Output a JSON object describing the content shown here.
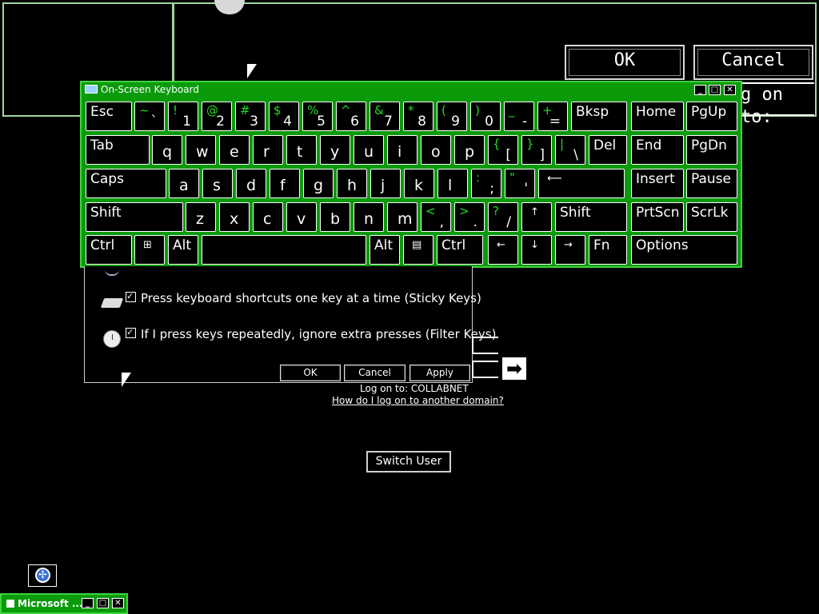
{
  "magnifier": {
    "ok_label": "OK",
    "cancel_label": "Cancel",
    "logon_partial": "g on to:"
  },
  "osk": {
    "title": "On-Screen Keyboard",
    "rows": [
      [
        {
          "id": "esc",
          "label": "Esc"
        },
        {
          "id": "backtick",
          "shift": "~",
          "main": "`"
        },
        {
          "id": "1",
          "shift": "!",
          "main": "1"
        },
        {
          "id": "2",
          "shift": "@",
          "main": "2"
        },
        {
          "id": "3",
          "shift": "#",
          "main": "3"
        },
        {
          "id": "4",
          "shift": "$",
          "main": "4"
        },
        {
          "id": "5",
          "shift": "%",
          "main": "5"
        },
        {
          "id": "6",
          "shift": "^",
          "main": "6"
        },
        {
          "id": "7",
          "shift": "&",
          "main": "7"
        },
        {
          "id": "8",
          "shift": "*",
          "main": "8"
        },
        {
          "id": "9",
          "shift": "(",
          "main": "9"
        },
        {
          "id": "0",
          "shift": ")",
          "main": "0"
        },
        {
          "id": "minus",
          "shift": "_",
          "main": "-"
        },
        {
          "id": "equals",
          "shift": "+",
          "main": "="
        },
        {
          "id": "bksp",
          "label": "Bksp"
        },
        {
          "id": "home",
          "label": "Home"
        },
        {
          "id": "pgup",
          "label": "PgUp"
        }
      ],
      [
        {
          "id": "tab",
          "label": "Tab"
        },
        {
          "id": "q",
          "single": "q"
        },
        {
          "id": "w",
          "single": "w"
        },
        {
          "id": "e",
          "single": "e"
        },
        {
          "id": "r",
          "single": "r"
        },
        {
          "id": "t",
          "single": "t"
        },
        {
          "id": "y",
          "single": "y"
        },
        {
          "id": "u",
          "single": "u"
        },
        {
          "id": "i",
          "single": "i"
        },
        {
          "id": "o",
          "single": "o"
        },
        {
          "id": "p",
          "single": "p"
        },
        {
          "id": "lbracket",
          "shift": "{",
          "main": "["
        },
        {
          "id": "rbracket",
          "shift": "}",
          "main": "]"
        },
        {
          "id": "backslash",
          "shift": "|",
          "main": "\\"
        },
        {
          "id": "del",
          "label": "Del"
        },
        {
          "id": "end",
          "label": "End"
        },
        {
          "id": "pgdn",
          "label": "PgDn"
        }
      ],
      [
        {
          "id": "caps",
          "label": "Caps"
        },
        {
          "id": "a",
          "single": "a"
        },
        {
          "id": "s",
          "single": "s"
        },
        {
          "id": "d",
          "single": "d"
        },
        {
          "id": "f",
          "single": "f"
        },
        {
          "id": "g",
          "single": "g"
        },
        {
          "id": "h",
          "single": "h"
        },
        {
          "id": "j",
          "single": "j"
        },
        {
          "id": "k",
          "single": "k"
        },
        {
          "id": "l",
          "single": "l"
        },
        {
          "id": "semicolon",
          "shift": ":",
          "main": ";"
        },
        {
          "id": "quote",
          "shift": "\"",
          "main": "'"
        },
        {
          "id": "enter",
          "label": "⟵"
        },
        {
          "id": "insert",
          "label": "Insert"
        },
        {
          "id": "pause",
          "label": "Pause"
        }
      ],
      [
        {
          "id": "lshift",
          "label": "Shift"
        },
        {
          "id": "z",
          "single": "z"
        },
        {
          "id": "x",
          "single": "x"
        },
        {
          "id": "c",
          "single": "c"
        },
        {
          "id": "v",
          "single": "v"
        },
        {
          "id": "b",
          "single": "b"
        },
        {
          "id": "n",
          "single": "n"
        },
        {
          "id": "m",
          "single": "m"
        },
        {
          "id": "comma",
          "shift": "<",
          "main": ","
        },
        {
          "id": "period",
          "shift": ">",
          "main": "."
        },
        {
          "id": "slash",
          "shift": "?",
          "main": "/"
        },
        {
          "id": "up",
          "label": "↑"
        },
        {
          "id": "rshift",
          "label": "Shift"
        },
        {
          "id": "prtscn",
          "label": "PrtScn"
        },
        {
          "id": "scrlk",
          "label": "ScrLk"
        }
      ],
      [
        {
          "id": "lctrl",
          "label": "Ctrl"
        },
        {
          "id": "win",
          "label": "⊞"
        },
        {
          "id": "lalt",
          "label": "Alt"
        },
        {
          "id": "space",
          "label": ""
        },
        {
          "id": "ralt",
          "label": "Alt"
        },
        {
          "id": "menu",
          "label": "▤"
        },
        {
          "id": "rctrl",
          "label": "Ctrl"
        },
        {
          "id": "left",
          "label": "←"
        },
        {
          "id": "down",
          "label": "↓"
        },
        {
          "id": "right",
          "label": "→"
        },
        {
          "id": "fn",
          "label": "Fn"
        },
        {
          "id": "options",
          "label": "Options"
        }
      ]
    ]
  },
  "accessibility": {
    "sticky_keys": "Press keyboard shortcuts one key at a time (Sticky Keys)",
    "filter_keys": "If I press keys repeatedly, ignore extra presses (Filter Keys)",
    "ok": "OK",
    "cancel": "Cancel",
    "apply": "Apply"
  },
  "login": {
    "go_arrow": "➡",
    "logon_to": "Log on to: COLLABNET",
    "another_domain": "How do I log on to another domain?",
    "switch_user": "Switch User"
  },
  "taskbar": {
    "title": "Microsoft ..."
  },
  "icons": [
    "keyboard-icon",
    "minimize-icon",
    "maximize-icon",
    "close-icon",
    "ease-of-access-icon",
    "sticky-keys-icon",
    "filter-keys-icon",
    "windows-logo-icon",
    "menu-key-icon",
    "go-arrow-icon"
  ]
}
